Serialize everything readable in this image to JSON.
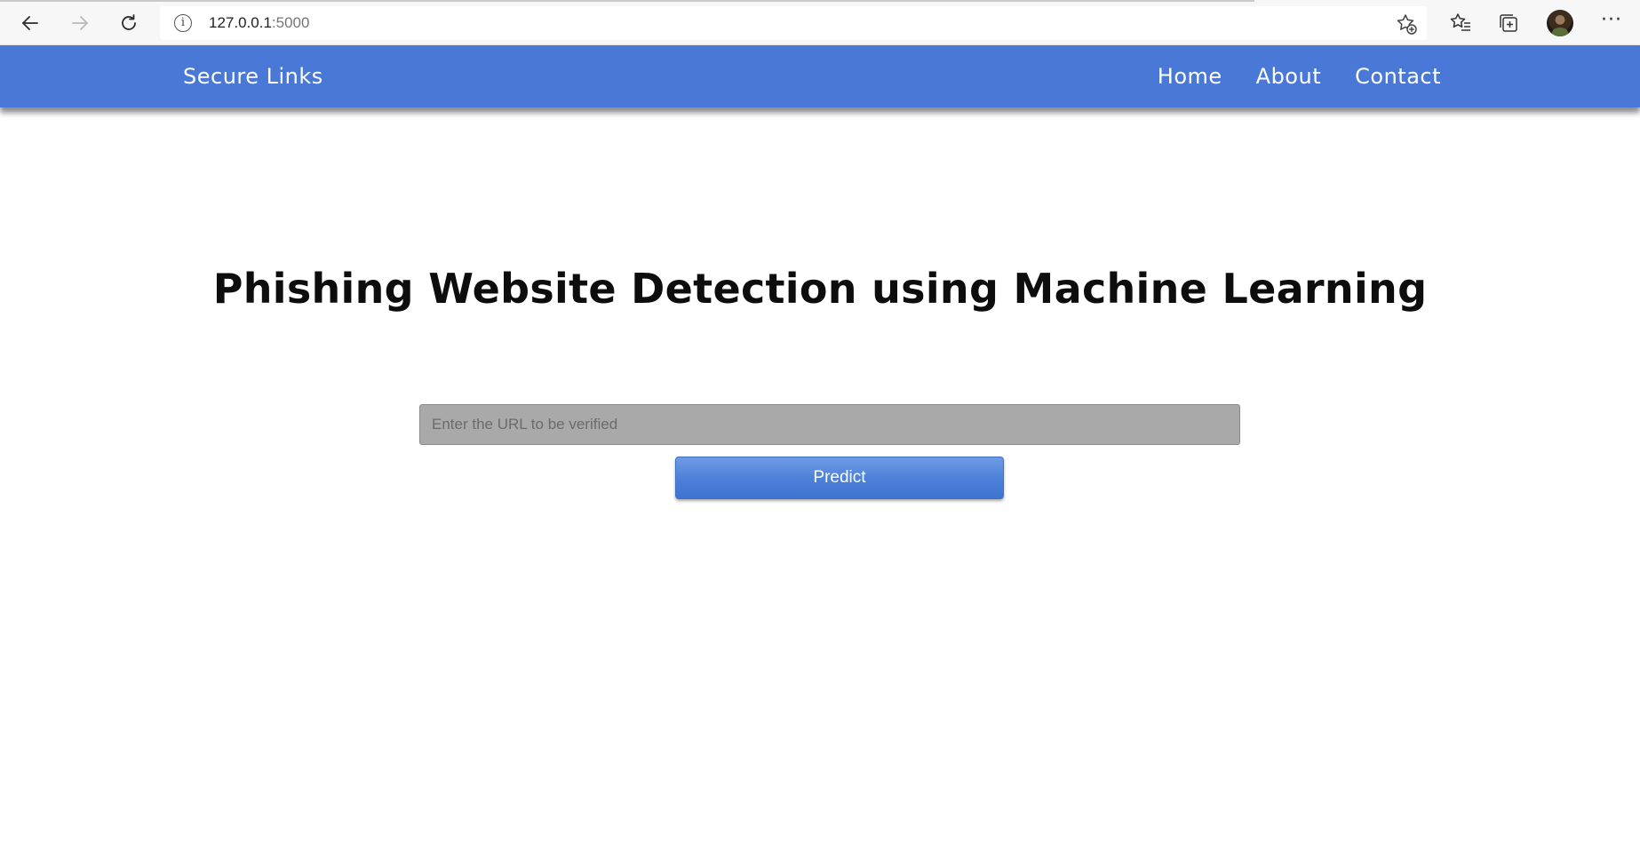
{
  "browser": {
    "url_host": "127.0.0.1",
    "url_port": ":5000",
    "back_icon": "arrow-left-icon",
    "forward_icon": "arrow-right-icon",
    "refresh_icon": "refresh-icon",
    "info_icon": "info-icon",
    "info_glyph": "i",
    "favorite_add_icon": "star-plus-icon",
    "favorites_icon": "favorites-list-icon",
    "collections_icon": "collections-icon",
    "profile_icon": "avatar",
    "menu_icon": "more-icon",
    "menu_glyph": "···"
  },
  "navbar": {
    "brand": "Secure Links",
    "links": [
      "Home",
      "About",
      "Contact"
    ],
    "background_color": "#4a78d6"
  },
  "main": {
    "title": "Phishing Website Detection using Machine Learning",
    "url_input": {
      "placeholder": "Enter the URL to be verified",
      "value": ""
    },
    "predict_label": "Predict"
  }
}
